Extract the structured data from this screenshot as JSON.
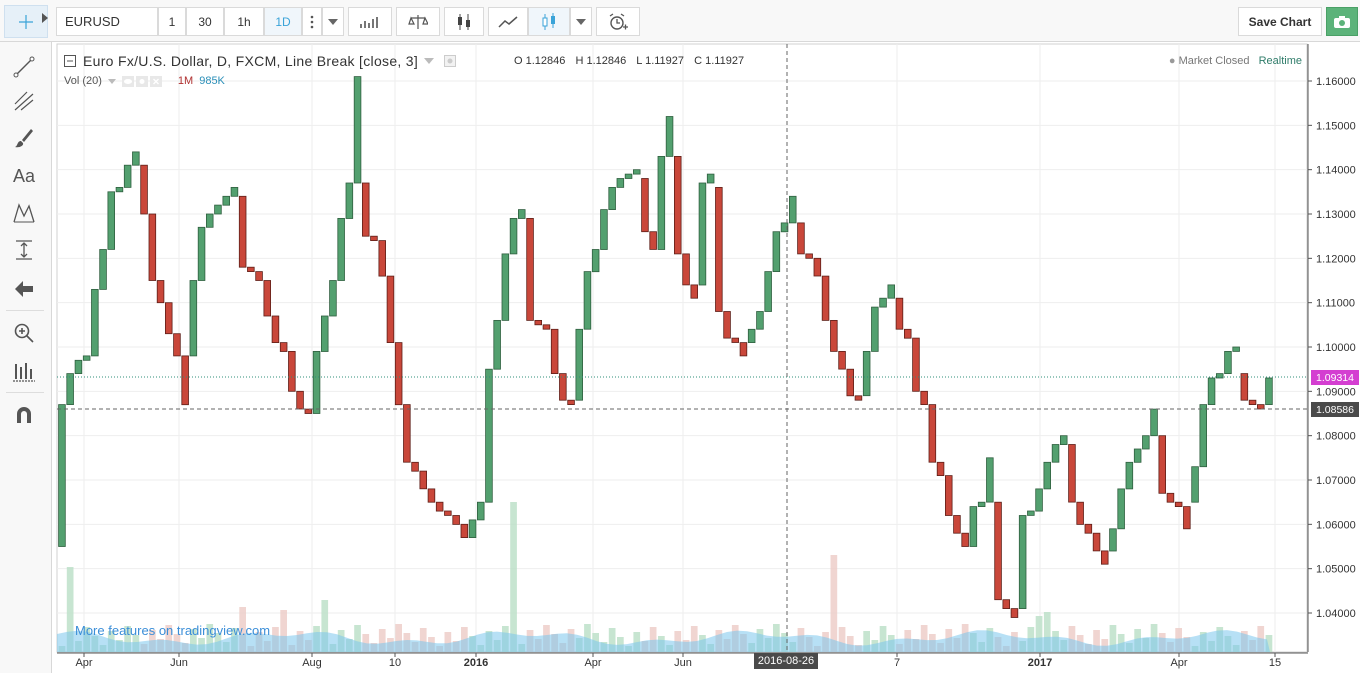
{
  "toolbar": {
    "symbol": "EURUSD",
    "intervals": [
      "1",
      "30",
      "1h",
      "1D"
    ],
    "active_interval": "1D",
    "save_label": "Save Chart"
  },
  "legend": {
    "title": "Euro Fx/U.S. Dollar, D, FXCM, Line Break [close, 3]",
    "o_label": "O",
    "o_value": "1.12846",
    "h_label": "H",
    "h_value": "1.12846",
    "l_label": "L",
    "l_value": "1.11927",
    "c_label": "C",
    "c_value": "1.11927",
    "vol_label": "Vol (20)",
    "vol_value_1": "1M",
    "vol_value_2": "985K",
    "market_status": "Market Closed",
    "realtime": "Realtime"
  },
  "promo": "More features on tradingview.com",
  "price_axis": [
    "1.16000",
    "1.15000",
    "1.14000",
    "1.13000",
    "1.12000",
    "1.11000",
    "1.10000",
    "1.09000",
    "1.08000",
    "1.07000",
    "1.06000",
    "1.05000",
    "1.04000"
  ],
  "price_tags": {
    "last": "1.09314",
    "crosshair": "1.08586"
  },
  "time_axis": [
    "Apr",
    "Jun",
    "Aug",
    "10",
    "2016",
    "Apr",
    "Jun",
    "7",
    "2017",
    "Apr",
    "15"
  ],
  "crosshair_date": "2016-08-26",
  "colors": {
    "up": "#53a06f",
    "down": "#c9473a",
    "last_price": "#d43ed1",
    "accent": "#3aa3d8"
  },
  "chart_data": {
    "type": "line_break",
    "title": "Euro Fx/U.S. Dollar, D, FXCM, Line Break [close, 3]",
    "ylim": [
      1.032,
      1.165
    ],
    "bricks_open_close": [
      [
        1.055,
        1.087
      ],
      [
        1.087,
        1.094
      ],
      [
        1.094,
        1.097
      ],
      [
        1.097,
        1.098
      ],
      [
        1.098,
        1.113
      ],
      [
        1.113,
        1.122
      ],
      [
        1.122,
        1.135
      ],
      [
        1.135,
        1.136
      ],
      [
        1.136,
        1.141
      ],
      [
        1.141,
        1.144
      ],
      [
        1.141,
        1.13
      ],
      [
        1.13,
        1.115
      ],
      [
        1.115,
        1.11
      ],
      [
        1.11,
        1.103
      ],
      [
        1.103,
        1.098
      ],
      [
        1.098,
        1.087
      ],
      [
        1.098,
        1.115
      ],
      [
        1.115,
        1.127
      ],
      [
        1.127,
        1.13
      ],
      [
        1.13,
        1.132
      ],
      [
        1.132,
        1.134
      ],
      [
        1.134,
        1.136
      ],
      [
        1.134,
        1.118
      ],
      [
        1.118,
        1.117
      ],
      [
        1.117,
        1.115
      ],
      [
        1.115,
        1.107
      ],
      [
        1.107,
        1.101
      ],
      [
        1.101,
        1.099
      ],
      [
        1.099,
        1.09
      ],
      [
        1.09,
        1.086
      ],
      [
        1.086,
        1.085
      ],
      [
        1.085,
        1.099
      ],
      [
        1.099,
        1.107
      ],
      [
        1.107,
        1.115
      ],
      [
        1.115,
        1.129
      ],
      [
        1.129,
        1.137
      ],
      [
        1.137,
        1.161
      ],
      [
        1.137,
        1.125
      ],
      [
        1.125,
        1.124
      ],
      [
        1.124,
        1.116
      ],
      [
        1.116,
        1.101
      ],
      [
        1.101,
        1.087
      ],
      [
        1.087,
        1.074
      ],
      [
        1.074,
        1.072
      ],
      [
        1.072,
        1.068
      ],
      [
        1.068,
        1.065
      ],
      [
        1.065,
        1.063
      ],
      [
        1.063,
        1.062
      ],
      [
        1.062,
        1.06
      ],
      [
        1.06,
        1.057
      ],
      [
        1.057,
        1.061
      ],
      [
        1.061,
        1.065
      ],
      [
        1.065,
        1.095
      ],
      [
        1.095,
        1.106
      ],
      [
        1.106,
        1.121
      ],
      [
        1.121,
        1.129
      ],
      [
        1.129,
        1.131
      ],
      [
        1.129,
        1.106
      ],
      [
        1.106,
        1.105
      ],
      [
        1.105,
        1.104
      ],
      [
        1.104,
        1.094
      ],
      [
        1.094,
        1.088
      ],
      [
        1.088,
        1.087
      ],
      [
        1.088,
        1.104
      ],
      [
        1.104,
        1.117
      ],
      [
        1.117,
        1.122
      ],
      [
        1.122,
        1.131
      ],
      [
        1.131,
        1.136
      ],
      [
        1.136,
        1.138
      ],
      [
        1.138,
        1.139
      ],
      [
        1.139,
        1.14
      ],
      [
        1.138,
        1.126
      ],
      [
        1.126,
        1.122
      ],
      [
        1.122,
        1.143
      ],
      [
        1.143,
        1.152
      ],
      [
        1.143,
        1.121
      ],
      [
        1.121,
        1.114
      ],
      [
        1.114,
        1.111
      ],
      [
        1.114,
        1.137
      ],
      [
        1.137,
        1.139
      ],
      [
        1.136,
        1.108
      ],
      [
        1.108,
        1.102
      ],
      [
        1.102,
        1.101
      ],
      [
        1.101,
        1.098
      ],
      [
        1.101,
        1.104
      ],
      [
        1.104,
        1.108
      ],
      [
        1.108,
        1.117
      ],
      [
        1.117,
        1.126
      ],
      [
        1.126,
        1.128
      ],
      [
        1.128,
        1.134
      ],
      [
        1.128,
        1.121
      ],
      [
        1.121,
        1.12
      ],
      [
        1.12,
        1.116
      ],
      [
        1.116,
        1.106
      ],
      [
        1.106,
        1.099
      ],
      [
        1.099,
        1.095
      ],
      [
        1.095,
        1.089
      ],
      [
        1.089,
        1.088
      ],
      [
        1.089,
        1.099
      ],
      [
        1.099,
        1.109
      ],
      [
        1.109,
        1.111
      ],
      [
        1.111,
        1.114
      ],
      [
        1.111,
        1.104
      ],
      [
        1.104,
        1.102
      ],
      [
        1.102,
        1.09
      ],
      [
        1.09,
        1.087
      ],
      [
        1.087,
        1.074
      ],
      [
        1.074,
        1.071
      ],
      [
        1.071,
        1.062
      ],
      [
        1.062,
        1.058
      ],
      [
        1.058,
        1.055
      ],
      [
        1.055,
        1.064
      ],
      [
        1.064,
        1.065
      ],
      [
        1.065,
        1.075
      ],
      [
        1.065,
        1.043
      ],
      [
        1.043,
        1.041
      ],
      [
        1.041,
        1.039
      ],
      [
        1.041,
        1.062
      ],
      [
        1.062,
        1.063
      ],
      [
        1.063,
        1.068
      ],
      [
        1.068,
        1.074
      ],
      [
        1.074,
        1.078
      ],
      [
        1.078,
        1.08
      ],
      [
        1.078,
        1.065
      ],
      [
        1.065,
        1.06
      ],
      [
        1.06,
        1.058
      ],
      [
        1.058,
        1.054
      ],
      [
        1.054,
        1.051
      ],
      [
        1.054,
        1.059
      ],
      [
        1.059,
        1.068
      ],
      [
        1.068,
        1.074
      ],
      [
        1.074,
        1.077
      ],
      [
        1.077,
        1.08
      ],
      [
        1.08,
        1.086
      ],
      [
        1.08,
        1.067
      ],
      [
        1.067,
        1.065
      ],
      [
        1.065,
        1.064
      ],
      [
        1.064,
        1.059
      ],
      [
        1.065,
        1.073
      ],
      [
        1.073,
        1.087
      ],
      [
        1.087,
        1.093
      ],
      [
        1.093,
        1.094
      ],
      [
        1.094,
        1.099
      ],
      [
        1.099,
        1.1
      ],
      [
        1.094,
        1.088
      ],
      [
        1.088,
        1.087
      ],
      [
        1.087,
        1.086
      ],
      [
        1.087,
        1.093
      ]
    ],
    "volume_scale_max": 1.0
  }
}
